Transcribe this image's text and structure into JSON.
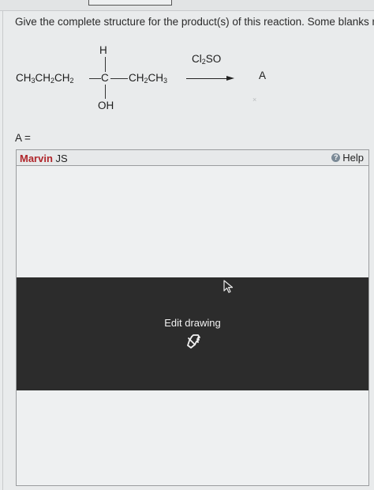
{
  "question": {
    "text": "Give the complete structure for the product(s) of this reaction. Some blanks m"
  },
  "reaction": {
    "left_group": {
      "p1": "CH",
      "s1": "3",
      "p2": "CH",
      "s2": "2",
      "p3": "CH",
      "s3": "2"
    },
    "center_atom": "C",
    "top_atom": "H",
    "bottom_atom": "OH",
    "right_group": {
      "p1": "CH",
      "s1": "2",
      "p2": "CH",
      "s2": "3"
    },
    "reagent": {
      "p1": "Cl",
      "s1": "2",
      "p2": "SO"
    },
    "product_label": "A",
    "smudge": "×"
  },
  "answer_label": "A =",
  "editor": {
    "title_brand": "Marvin",
    "title_suffix": " JS",
    "help_label": "Help",
    "help_icon_glyph": "?",
    "overlay_text": "Edit drawing",
    "icons": [
      "help-icon",
      "hand-pointer-icon",
      "arrow-cursor-icon"
    ]
  },
  "colors": {
    "brand": "#b0262b",
    "overlay": "#2c2c2c",
    "page_bg": "#e9ebec"
  }
}
